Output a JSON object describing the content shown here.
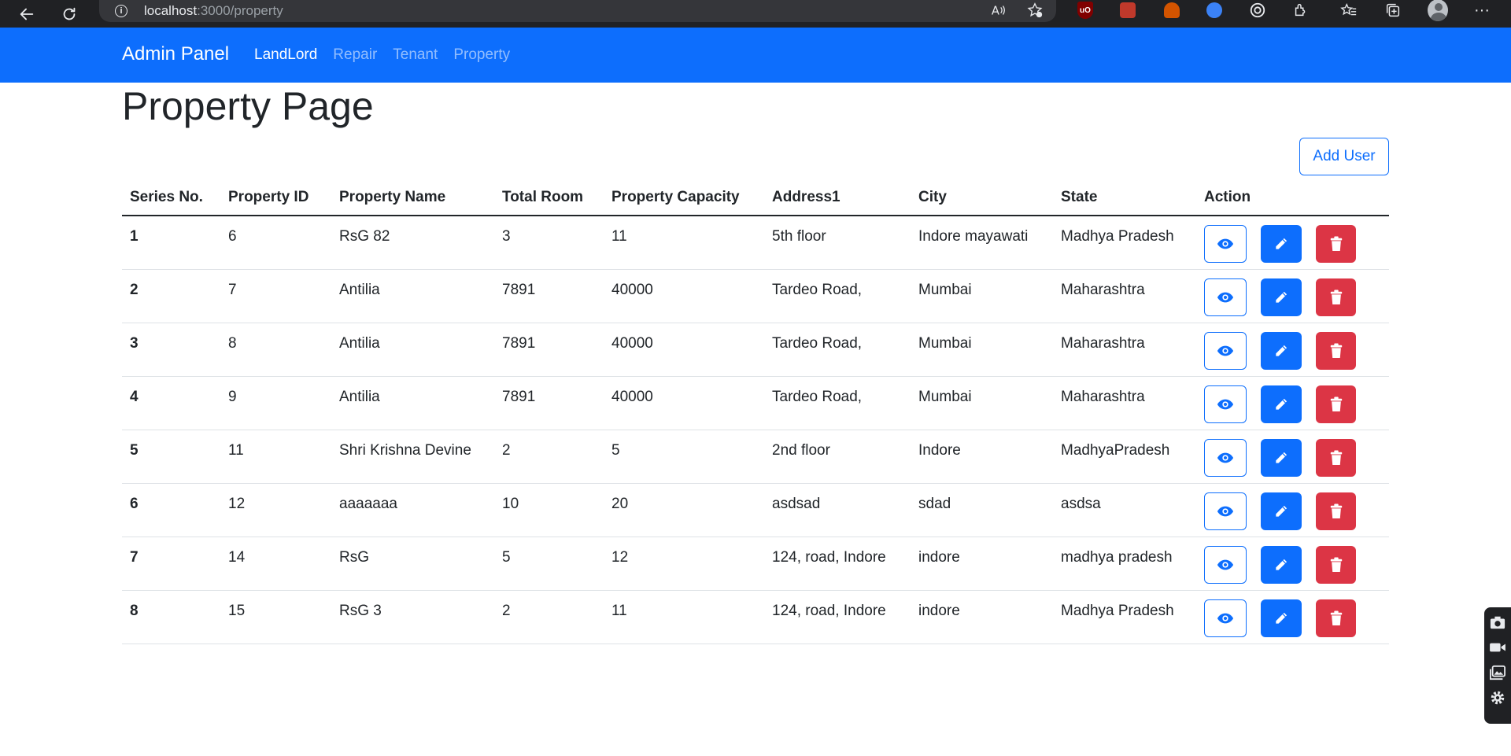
{
  "browser": {
    "url_host": "localhost",
    "url_rest": ":3000/property"
  },
  "navbar": {
    "brand": "Admin Panel",
    "links": [
      {
        "label": "LandLord",
        "active": true
      },
      {
        "label": "Repair",
        "active": false
      },
      {
        "label": "Tenant",
        "active": false
      },
      {
        "label": "Property",
        "active": false
      }
    ]
  },
  "page": {
    "title": "Property Page",
    "add_button": "Add User"
  },
  "table": {
    "headers": [
      "Series No.",
      "Property ID",
      "Property Name",
      "Total Room",
      "Property Capacity",
      "Address1",
      "City",
      "State",
      "Action"
    ],
    "rows": [
      {
        "series": "1",
        "id": "6",
        "name": "RsG 82",
        "rooms": "3",
        "capacity": "11",
        "address": "5th floor",
        "city": "Indore mayawati",
        "state": "Madhya Pradesh"
      },
      {
        "series": "2",
        "id": "7",
        "name": "Antilia",
        "rooms": "7891",
        "capacity": "40000",
        "address": "Tardeo Road,",
        "city": "Mumbai",
        "state": "Maharashtra"
      },
      {
        "series": "3",
        "id": "8",
        "name": "Antilia",
        "rooms": "7891",
        "capacity": "40000",
        "address": "Tardeo Road,",
        "city": "Mumbai",
        "state": "Maharashtra"
      },
      {
        "series": "4",
        "id": "9",
        "name": "Antilia",
        "rooms": "7891",
        "capacity": "40000",
        "address": "Tardeo Road,",
        "city": "Mumbai",
        "state": "Maharashtra"
      },
      {
        "series": "5",
        "id": "11",
        "name": "Shri Krishna Devine",
        "rooms": "2",
        "capacity": "5",
        "address": "2nd floor",
        "city": "Indore",
        "state": "MadhyaPradesh"
      },
      {
        "series": "6",
        "id": "12",
        "name": "aaaaaaa",
        "rooms": "10",
        "capacity": "20",
        "address": "asdsad",
        "city": "sdad",
        "state": "asdsa"
      },
      {
        "series": "7",
        "id": "14",
        "name": "RsG",
        "rooms": "5",
        "capacity": "12",
        "address": "124, road, Indore",
        "city": "indore",
        "state": "madhya pradesh"
      },
      {
        "series": "8",
        "id": "15",
        "name": "RsG 3",
        "rooms": "2",
        "capacity": "11",
        "address": "124, road, Indore",
        "city": "indore",
        "state": "Madhya Pradesh"
      }
    ]
  },
  "colors": {
    "primary": "#0d6efd",
    "danger": "#dc3545",
    "browser_chrome": "#202124"
  }
}
